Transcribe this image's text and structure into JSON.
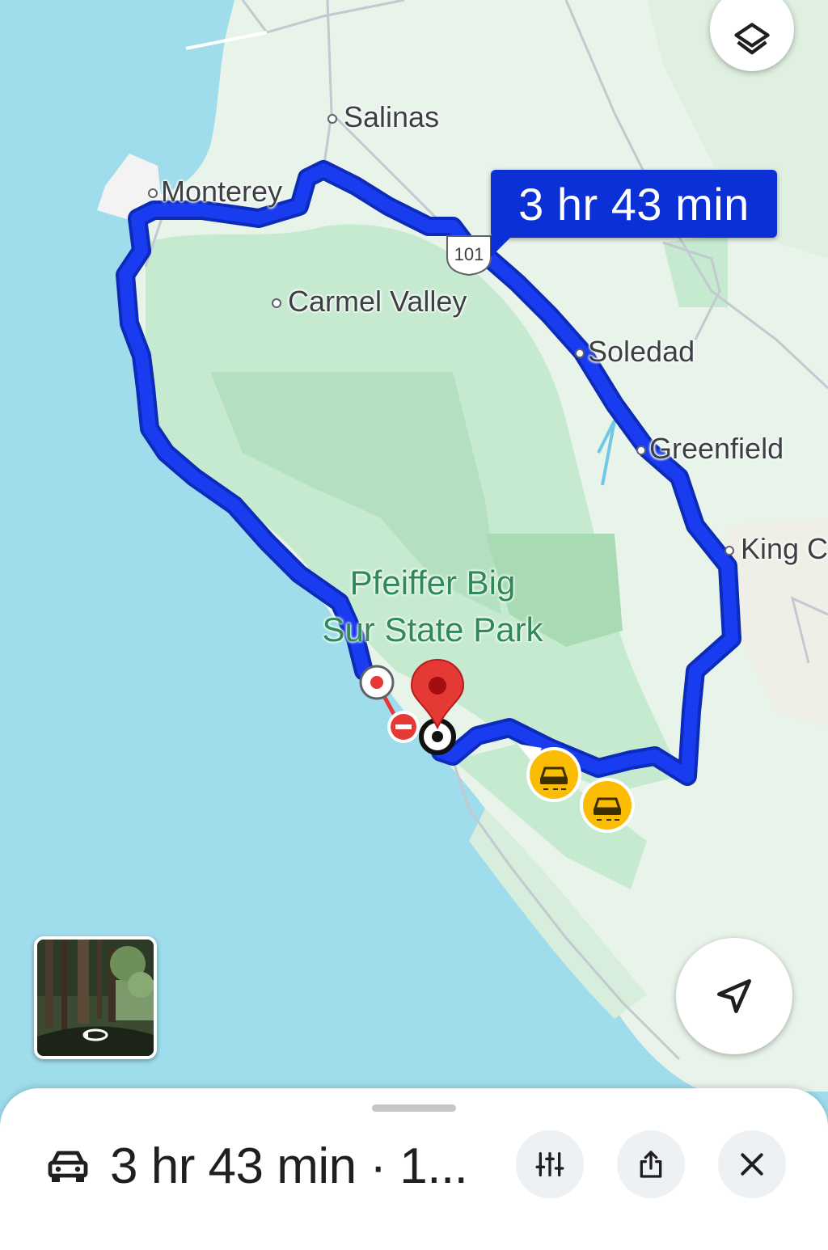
{
  "map": {
    "places": [
      {
        "id": "salinas",
        "label": "Salinas"
      },
      {
        "id": "monterey",
        "label": "Monterey"
      },
      {
        "id": "carmel-valley",
        "label": "Carmel Valley"
      },
      {
        "id": "soledad",
        "label": "Soledad"
      },
      {
        "id": "greenfield",
        "label": "Greenfield"
      },
      {
        "id": "king-city",
        "label": "King C"
      }
    ],
    "park_label_line1": "Pfeiffer Big",
    "park_label_line2": "Sur State Park",
    "highway_shield": "101",
    "route_eta": "3 hr 43 min",
    "colors": {
      "water": "#9fdcec",
      "land": "#e8f3ea",
      "park": "#b7e3c1",
      "route": "#1a3cf0",
      "route_outline": "#0b2bb8",
      "destination_pin": "#e53935",
      "traffic_alert": "#fbbc04"
    },
    "icons": [
      "layers-icon",
      "navigate-arrow-icon",
      "destination-pin-icon",
      "road-closed-icon",
      "traffic-incident-icon"
    ]
  },
  "sheet": {
    "mode_icon": "car-icon",
    "summary": "3 hr 43 min · 1...",
    "buttons": [
      "route-options-icon",
      "share-icon",
      "close-icon"
    ]
  }
}
